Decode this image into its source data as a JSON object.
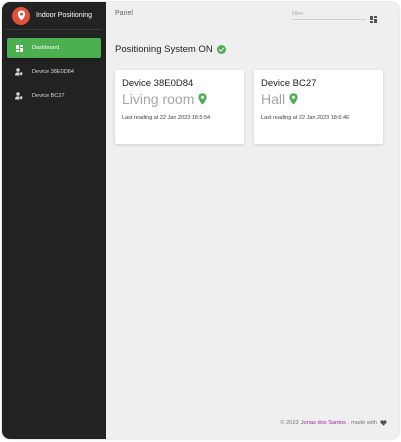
{
  "brand": {
    "title": "Indoor Positioning",
    "logo_icon": "map-pin-icon",
    "logo_color": "#e0513c"
  },
  "sidebar": {
    "items": [
      {
        "label": "Dashboard",
        "icon": "dashboard-icon",
        "active": true
      },
      {
        "label": "Device 38E0D84",
        "icon": "person-location-icon",
        "active": false
      },
      {
        "label": "Device BC27",
        "icon": "person-location-icon",
        "active": false
      }
    ]
  },
  "header": {
    "panel_title": "Panel",
    "filter_placeholder": "Filter...",
    "apps_icon": "apps-grid-icon"
  },
  "main": {
    "status_text": "Positioning System ON",
    "status_icon": "check-circle-icon",
    "status_color": "#4caf50",
    "devices": [
      {
        "name": "Device 38E0D84",
        "location": "Living room",
        "last_reading": "Last reading at 22 Jan 2023 18:5:54"
      },
      {
        "name": "Device BC27",
        "location": "Hall",
        "last_reading": "Last reading at 22 Jan 2023 18:6:46"
      }
    ]
  },
  "footer": {
    "prefix": "© 2023",
    "author": "Jonas dos Santos",
    "suffix": ", made with",
    "icon": "heart-icon"
  },
  "colors": {
    "accent": "#4caf50",
    "sidebar_bg": "#222222",
    "author_link": "#9c27b0"
  }
}
